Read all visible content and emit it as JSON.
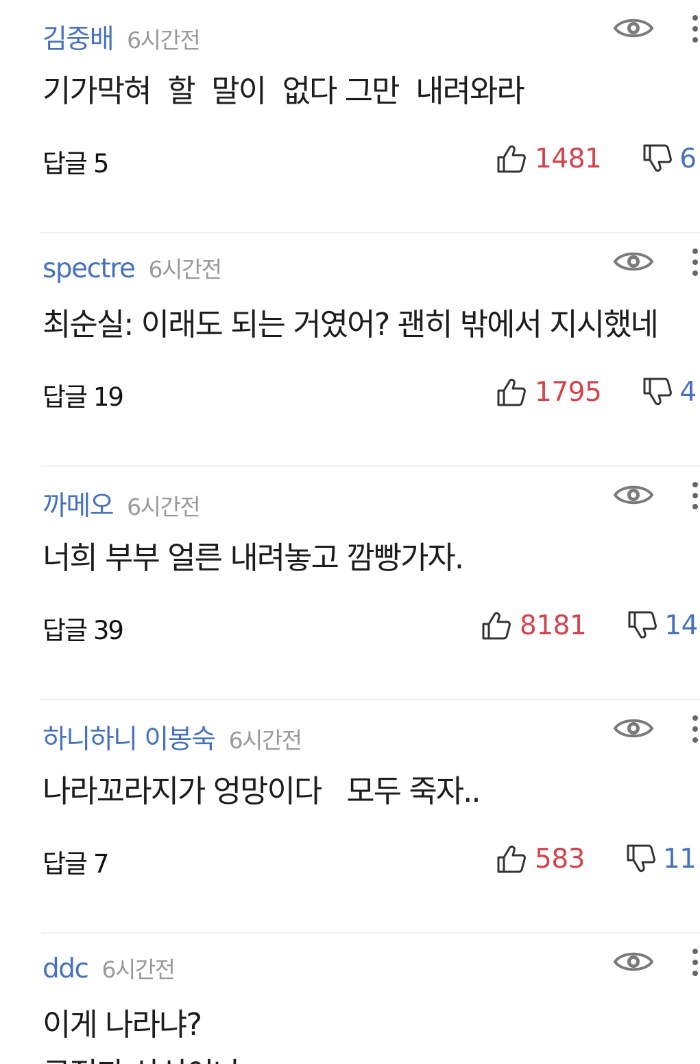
{
  "comments": [
    {
      "author": "김중배",
      "time": "6시간전",
      "text": "기가막혀  할  말이  없다 그만  내려와라",
      "text2": "",
      "reply_label": "답글 5",
      "likes": "1481",
      "dislikes": "6"
    },
    {
      "author": "spectre",
      "time": "6시간전",
      "text": "최순실: 이래도 되는 거였어? 괜히 밖에서 지시했네",
      "text2": "",
      "reply_label": "답글 19",
      "likes": "1795",
      "dislikes": "4"
    },
    {
      "author": "까메오",
      "time": "6시간전",
      "text": "너희 부부 얼른 내려놓고 깜빵가자.",
      "text2": "",
      "reply_label": "답글 39",
      "likes": "8181",
      "dislikes": "14"
    },
    {
      "author": "하니하니 이봉숙",
      "time": "6시간전",
      "text": "나라꼬라지가 엉망이다   모두 죽자..",
      "text2": "",
      "reply_label": "답글 7",
      "likes": "583",
      "dislikes": "11"
    },
    {
      "author": "ddc",
      "time": "6시간전",
      "text": "이게 나라냐?",
      "text2": "공정과 상식이냐",
      "reply_label": "",
      "likes": "",
      "dislikes": ""
    }
  ],
  "icons": {
    "view": "eye-icon",
    "more": "more-vertical-icon",
    "like": "thumbs-up-icon",
    "dislike": "thumbs-down-icon"
  },
  "colors": {
    "author": "#4672bd",
    "like": "#d3434c",
    "dislike": "#4672bd",
    "time": "#9a9a9a"
  }
}
